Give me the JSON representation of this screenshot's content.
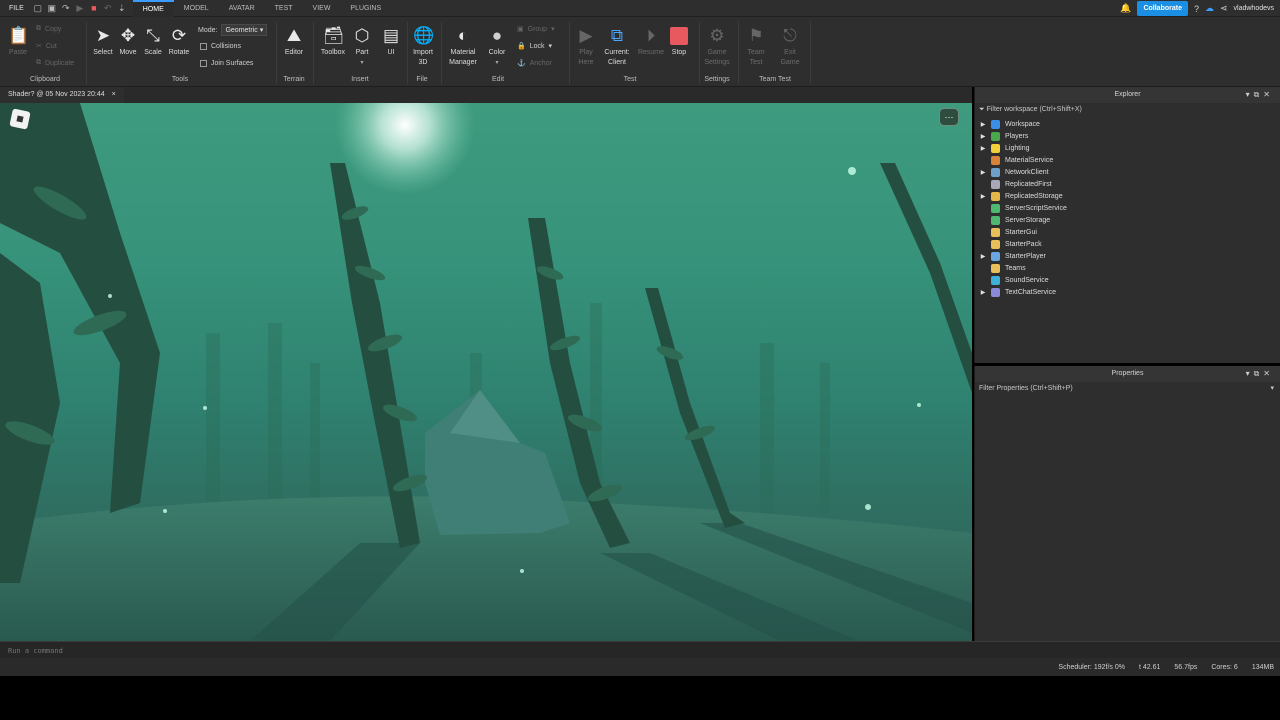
{
  "menubar": {
    "file": "FILE",
    "tabs": [
      "HOME",
      "MODEL",
      "AVATAR",
      "TEST",
      "VIEW",
      "PLUGINS"
    ],
    "active_tab": "HOME",
    "collaborate": "Collaborate",
    "username": "vladwhodevs"
  },
  "ribbon": {
    "clipboard": {
      "paste": "Paste",
      "copy": "Copy",
      "cut": "Cut",
      "duplicate": "Duplicate",
      "group_label": "Clipboard"
    },
    "tools": {
      "select": "Select",
      "move": "Move",
      "scale": "Scale",
      "rotate": "Rotate",
      "mode_label": "Mode:",
      "mode_value": "Geometric",
      "collisions": "Collisions",
      "join_surfaces": "Join Surfaces",
      "group_label": "Tools"
    },
    "terrain": {
      "editor": "Editor",
      "group_label": "Terrain"
    },
    "insert": {
      "toolbox": "Toolbox",
      "part": "Part",
      "ui": "UI",
      "group_label": "Insert"
    },
    "file": {
      "import3d_1": "Import",
      "import3d_2": "3D",
      "group_label": "File"
    },
    "edit": {
      "material_1": "Material",
      "material_2": "Manager",
      "color": "Color",
      "group": "Group",
      "lock": "Lock",
      "anchor": "Anchor",
      "group_label": "Edit"
    },
    "test": {
      "play_1": "Play",
      "play_2": "Here",
      "current_1": "Current:",
      "current_2": "Client",
      "resume": "Resume",
      "stop": "Stop",
      "group_label": "Test"
    },
    "settings": {
      "game_1": "Game",
      "game_2": "Settings",
      "group_label": "Settings"
    },
    "teamtest": {
      "team_1": "Team",
      "team_2": "Test",
      "exit_1": "Exit",
      "exit_2": "Game",
      "group_label": "Team Test"
    }
  },
  "document_tab": {
    "title": "Shader? @ 05 Nov 2023 20:44",
    "close": "×"
  },
  "explorer": {
    "title": "Explorer",
    "filter_placeholder": "Filter workspace (Ctrl+Shift+X)",
    "items": [
      {
        "label": "Workspace",
        "expandable": true,
        "color": "#3a8ee6"
      },
      {
        "label": "Players",
        "expandable": true,
        "color": "#49a84c"
      },
      {
        "label": "Lighting",
        "expandable": true,
        "color": "#f2d03b"
      },
      {
        "label": "MaterialService",
        "expandable": false,
        "color": "#d9823b"
      },
      {
        "label": "NetworkClient",
        "expandable": true,
        "color": "#6fa0c8"
      },
      {
        "label": "ReplicatedFirst",
        "expandable": false,
        "color": "#a8a8b8"
      },
      {
        "label": "ReplicatedStorage",
        "expandable": true,
        "color": "#e3b84a"
      },
      {
        "label": "ServerScriptService",
        "expandable": false,
        "color": "#4fb870"
      },
      {
        "label": "ServerStorage",
        "expandable": false,
        "color": "#4fb870"
      },
      {
        "label": "StarterGui",
        "expandable": false,
        "color": "#e8c05a"
      },
      {
        "label": "StarterPack",
        "expandable": false,
        "color": "#e8c05a"
      },
      {
        "label": "StarterPlayer",
        "expandable": true,
        "color": "#6aa6e0"
      },
      {
        "label": "Teams",
        "expandable": false,
        "color": "#e8c05a"
      },
      {
        "label": "SoundService",
        "expandable": false,
        "color": "#3fb0d8"
      },
      {
        "label": "TextChatService",
        "expandable": true,
        "color": "#8a8ad8"
      }
    ]
  },
  "properties": {
    "title": "Properties",
    "filter_placeholder": "Filter Properties (Ctrl+Shift+P)"
  },
  "command_bar": {
    "placeholder": "Run a command"
  },
  "status_bar": {
    "scheduler": "Scheduler: 192f/s 0%",
    "t": "t 42.61",
    "fps": "56.7fps",
    "cores": "Cores: 6",
    "memory": "134MB"
  }
}
